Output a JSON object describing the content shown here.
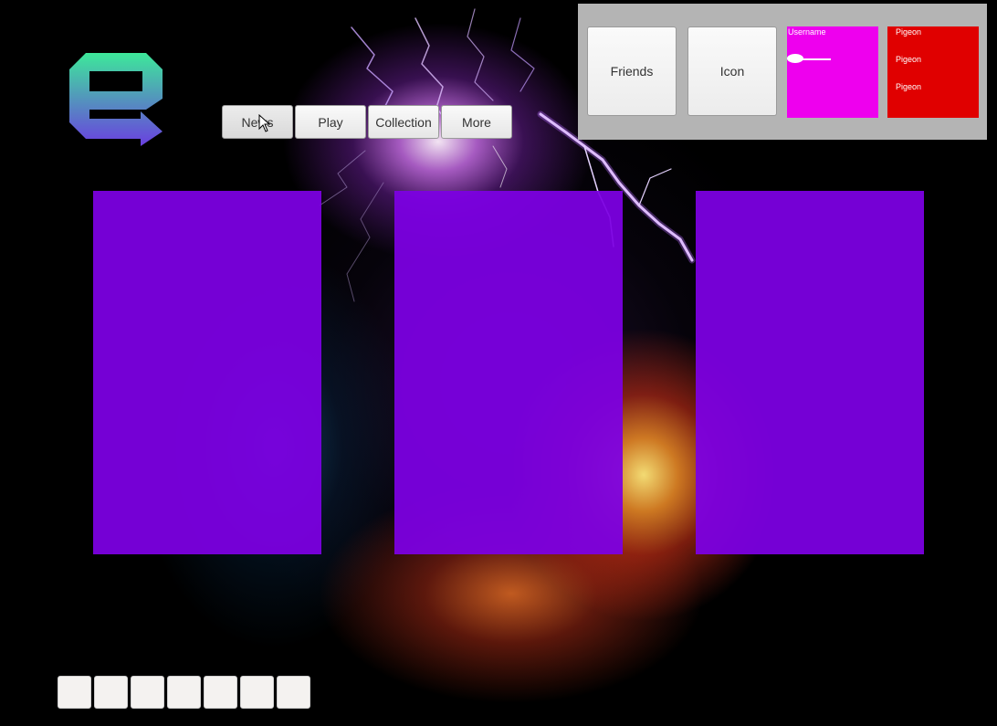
{
  "nav": {
    "items": [
      {
        "label": "News"
      },
      {
        "label": "Play"
      },
      {
        "label": "Collection"
      },
      {
        "label": "More"
      }
    ]
  },
  "social": {
    "friends_label": "Friends",
    "icon_label": "Icon",
    "username_label": "Username",
    "username_slider_value": 0,
    "friend_list": [
      "Pigeon",
      "Pigeon",
      "Pigeon"
    ]
  },
  "cards": [
    {
      "color": "#7c00e2"
    },
    {
      "color": "#7c00e2"
    },
    {
      "color": "#7c00e2"
    }
  ],
  "hotbar": {
    "slot_count": 7
  },
  "colors": {
    "panel_bg": "#b4b4b4",
    "username_card": "#ee00ee",
    "friend_list_bg": "#e00000",
    "card": "#7c00e2",
    "logo_top": "#3de89a",
    "logo_bottom": "#6a3fe0"
  },
  "icons": {
    "logo": "e-logo-arrow",
    "cursor": "mouse-pointer"
  }
}
